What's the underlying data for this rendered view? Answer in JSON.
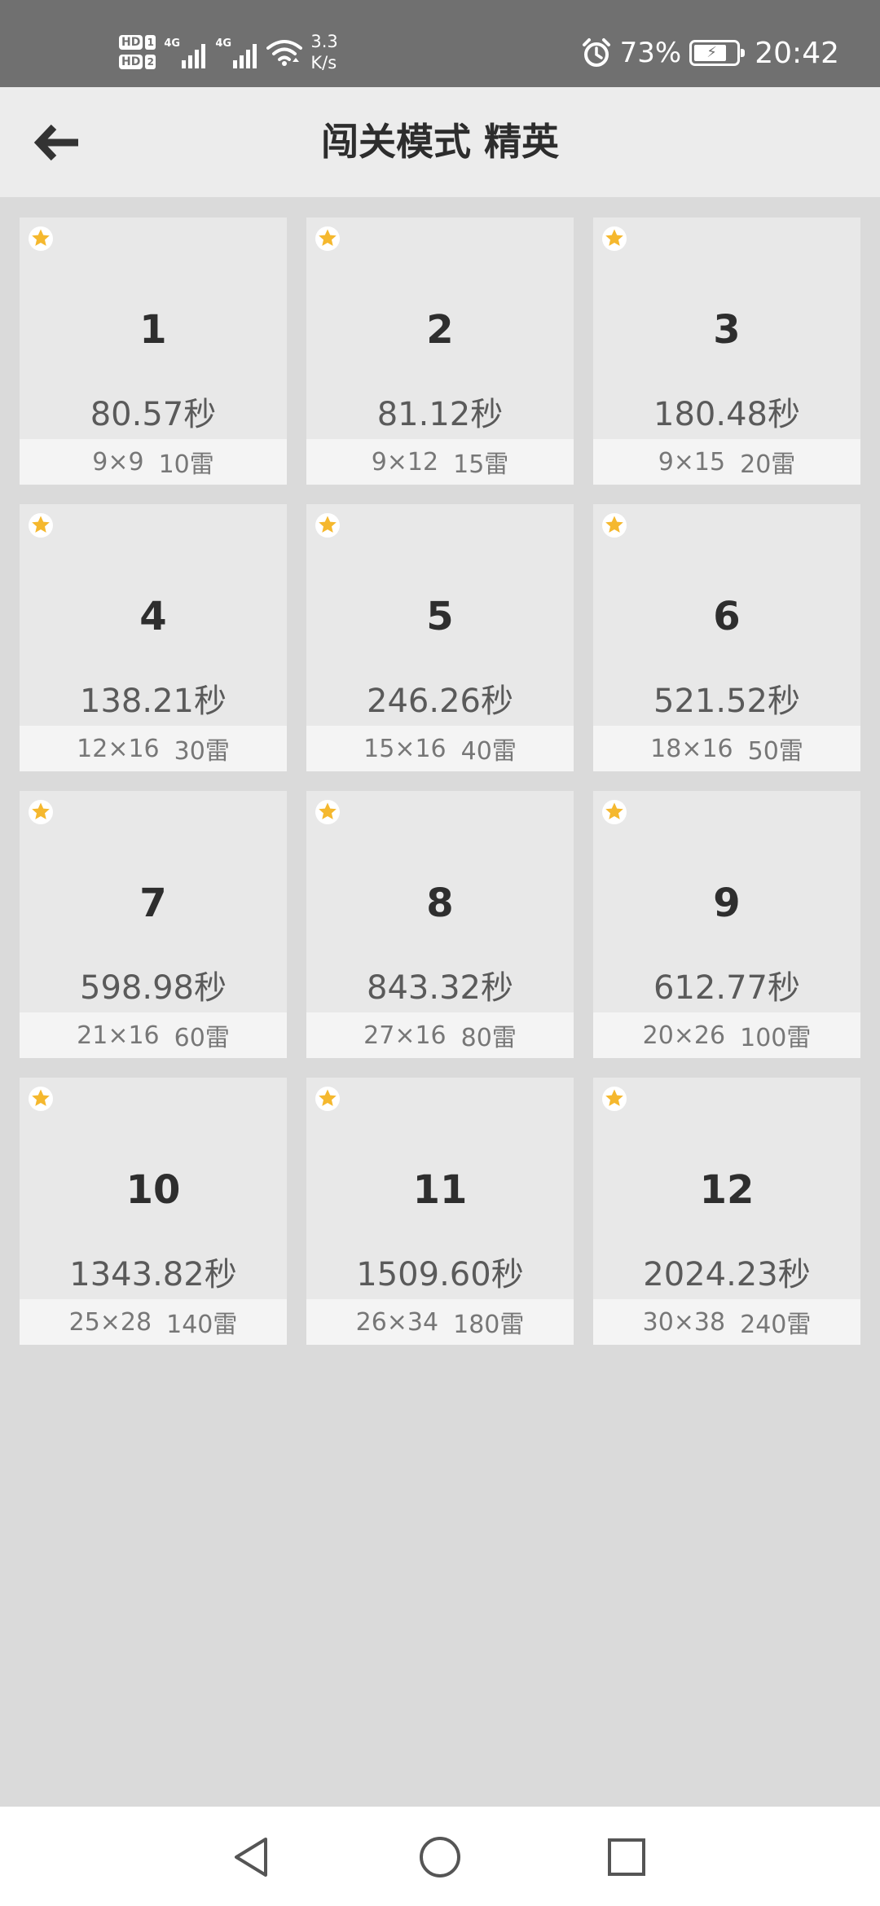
{
  "status_bar": {
    "hd1": "HD",
    "hd2": "HD",
    "sim1": "1",
    "sim2": "2",
    "net1": "4G",
    "net2": "4G",
    "speed_value": "3.3",
    "speed_unit": "K/s",
    "battery_percent": "73%",
    "time": "20:42",
    "icons": [
      "signal-icon",
      "wifi-icon",
      "alarm-icon",
      "battery-charging-icon"
    ]
  },
  "header": {
    "title": "闯关模式 精英",
    "back_icon": "arrow-left-icon"
  },
  "levels": [
    {
      "number": "1",
      "time": "80.57秒",
      "size": "9×9",
      "mines": "10雷"
    },
    {
      "number": "2",
      "time": "81.12秒",
      "size": "9×12",
      "mines": "15雷"
    },
    {
      "number": "3",
      "time": "180.48秒",
      "size": "9×15",
      "mines": "20雷"
    },
    {
      "number": "4",
      "time": "138.21秒",
      "size": "12×16",
      "mines": "30雷"
    },
    {
      "number": "5",
      "time": "246.26秒",
      "size": "15×16",
      "mines": "40雷"
    },
    {
      "number": "6",
      "time": "521.52秒",
      "size": "18×16",
      "mines": "50雷"
    },
    {
      "number": "7",
      "time": "598.98秒",
      "size": "21×16",
      "mines": "60雷"
    },
    {
      "number": "8",
      "time": "843.32秒",
      "size": "27×16",
      "mines": "80雷"
    },
    {
      "number": "9",
      "time": "612.77秒",
      "size": "20×26",
      "mines": "100雷"
    },
    {
      "number": "10",
      "time": "1343.82秒",
      "size": "25×28",
      "mines": "140雷"
    },
    {
      "number": "11",
      "time": "1509.60秒",
      "size": "26×34",
      "mines": "180雷"
    },
    {
      "number": "12",
      "time": "2024.23秒",
      "size": "30×38",
      "mines": "240雷"
    }
  ],
  "colors": {
    "status_bar_bg": "#707070",
    "app_bar_bg": "#ececec",
    "page_bg": "#dadada",
    "card_bg": "#e8e8e8",
    "star": "#f5b82e"
  },
  "nav": {
    "icons": [
      "back-triangle-icon",
      "home-circle-icon",
      "recents-square-icon"
    ]
  }
}
